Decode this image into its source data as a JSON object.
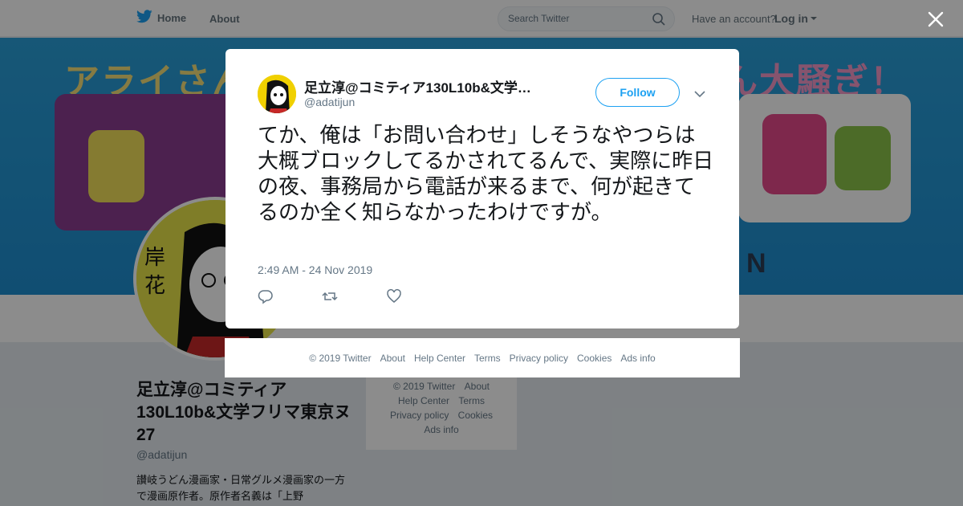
{
  "nav": {
    "home_label": "Home",
    "about_label": "About",
    "search_placeholder": "Search Twitter",
    "have_account": "Have an account?",
    "login_label": "Log in"
  },
  "banner": {
    "text_left": "アライさん",
    "text_right": "ん大騒ぎ！",
    "bottom_letter": "N"
  },
  "profile": {
    "name": "足立淳@コミティア130L10b&文学フリマ東京ヌ27",
    "handle": "@adatijun",
    "bio": "讃岐うどん漫画家・日常グルメ漫画家の一方で漫画原作者。原作者名義は「上野"
  },
  "side_footer": {
    "links": [
      "© 2019 Twitter",
      "About",
      "Help Center",
      "Terms",
      "Privacy policy",
      "Cookies",
      "Ads info"
    ]
  },
  "tweet": {
    "author_name": "足立淳@コミティア130L10b&文学…",
    "author_handle": "@adatijun",
    "follow_label": "Follow",
    "text": "てか、俺は「お問い合わせ」しそうなやつらは大概ブロックしてるかされてるんで、実際に昨日の夜、事務局から電話が来るまで、何が起きてるのか全く知らなかったわけですが。",
    "timestamp": "2:49 AM - 24 Nov 2019"
  },
  "modal_footer": {
    "links": [
      "© 2019 Twitter",
      "About",
      "Help Center",
      "Terms",
      "Privacy policy",
      "Cookies",
      "Ads info"
    ]
  },
  "colors": {
    "accent": "#1da1f2",
    "muted": "#657786",
    "overlay": "rgba(0,0,0,0.45)"
  },
  "icons": {
    "logo": "twitter-bird-icon",
    "search": "search-icon",
    "close": "close-icon",
    "caret": "chevron-down-icon",
    "reply": "reply-icon",
    "retweet": "retweet-icon",
    "like": "heart-icon"
  }
}
